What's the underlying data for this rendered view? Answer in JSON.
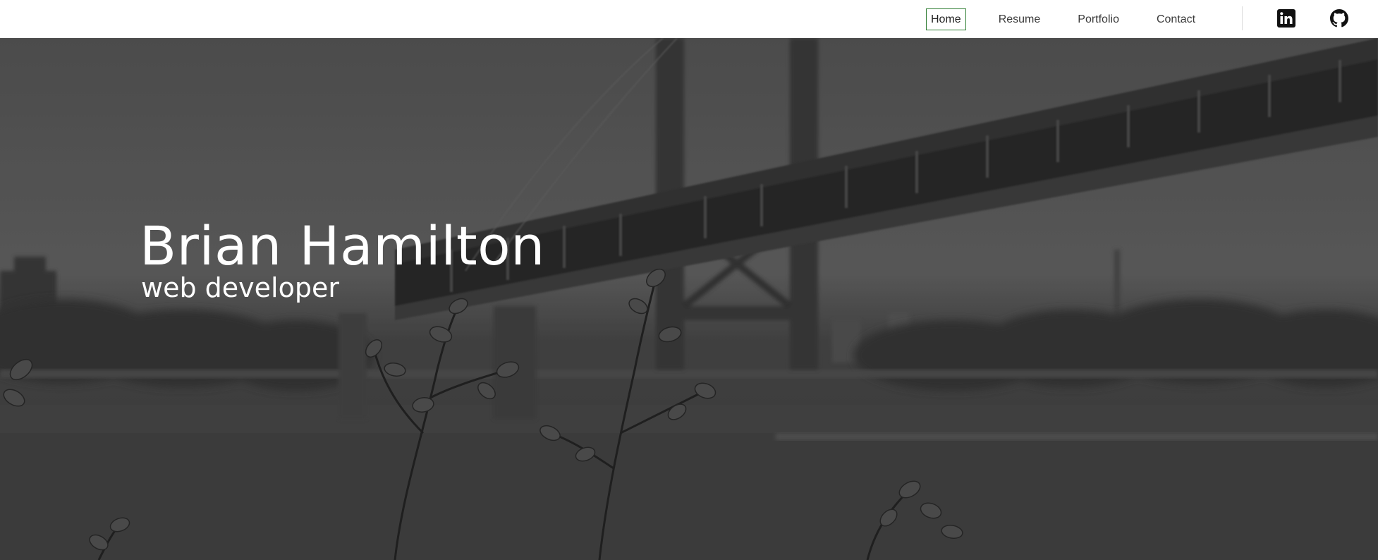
{
  "nav": {
    "links": [
      {
        "label": "Home",
        "active": true
      },
      {
        "label": "Resume",
        "active": false
      },
      {
        "label": "Portfolio",
        "active": false
      },
      {
        "label": "Contact",
        "active": false
      }
    ],
    "social": [
      {
        "name": "linkedin-icon"
      },
      {
        "name": "github-icon"
      }
    ],
    "active_border_color": "#2e7d32"
  },
  "hero": {
    "name": "Brian Hamilton",
    "subtitle": "web developer"
  }
}
